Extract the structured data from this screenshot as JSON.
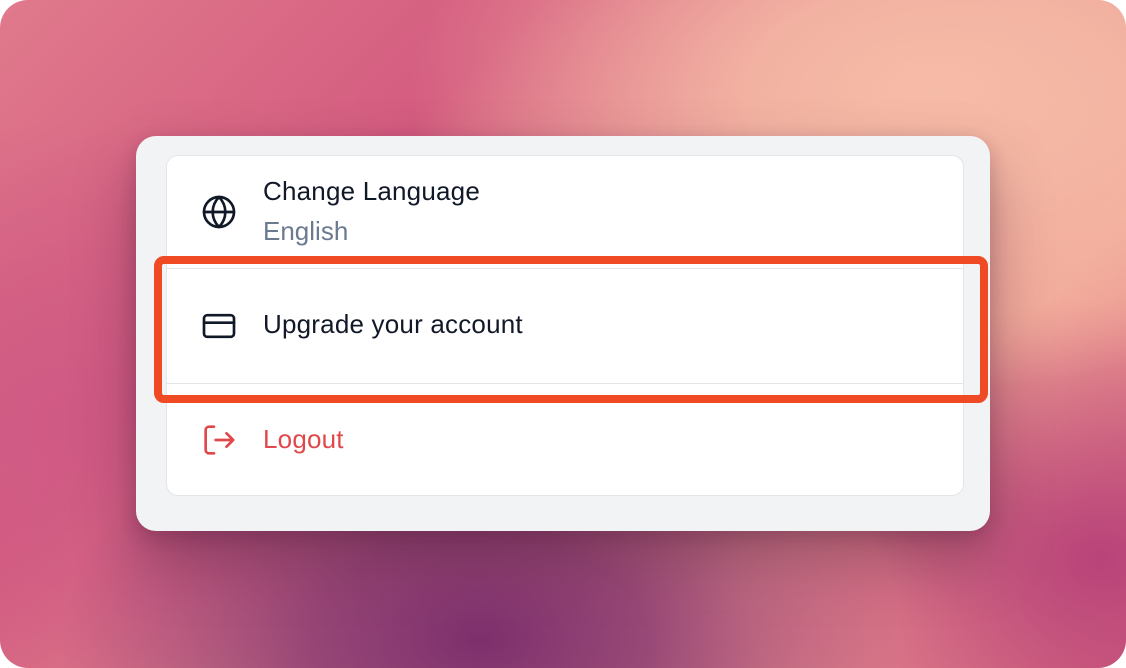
{
  "menu": {
    "items": [
      {
        "id": "change-language",
        "label": "Change Language",
        "sublabel": "English",
        "icon": "globe-icon"
      },
      {
        "id": "upgrade-account",
        "label": "Upgrade your account",
        "icon": "credit-card-icon",
        "highlighted": true
      },
      {
        "id": "logout",
        "label": "Logout",
        "icon": "logout-icon",
        "color": "#e0484a"
      }
    ]
  },
  "highlight": {
    "target": "upgrade-account",
    "color": "#f04a24"
  }
}
